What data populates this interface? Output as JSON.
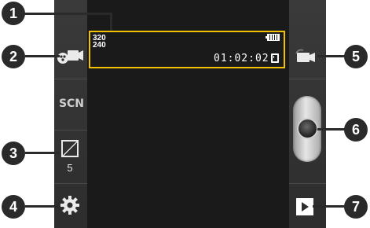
{
  "viewfinder": {
    "resolution_width": "320",
    "resolution_height": "240",
    "recording_time": "01:02:02"
  },
  "left_bar": {
    "scene_label": "SCN",
    "exposure_value": "5"
  },
  "callouts": [
    "1",
    "2",
    "3",
    "4",
    "5",
    "6",
    "7"
  ],
  "icons": {
    "battery": "battery-full-icon",
    "storage": "memory-card-icon",
    "mode": "camcorder-shooting-mode-icon",
    "exposure": "exposure-icon",
    "settings": "gear-icon",
    "switch": "switch-to-camera-icon",
    "record": "record-shutter-icon",
    "play": "play-icon"
  },
  "colors": {
    "highlight": "#f2c200",
    "callout": "#2a2a2a"
  }
}
